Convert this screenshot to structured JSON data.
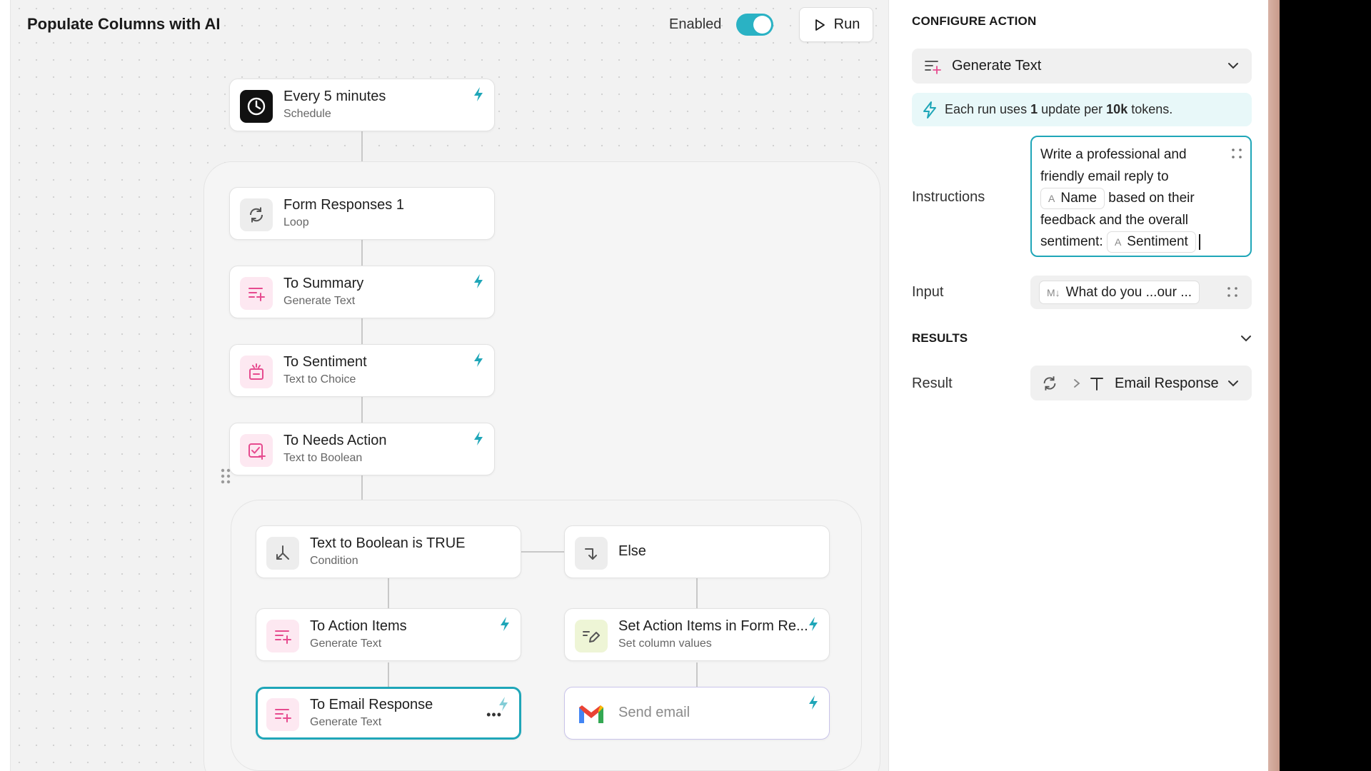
{
  "title": "Populate Columns with AI",
  "header": {
    "enabled_label": "Enabled",
    "enabled": true,
    "run_label": "Run"
  },
  "nodes": {
    "schedule": {
      "title": "Every 5 minutes",
      "subtitle": "Schedule",
      "icon": "clock-icon"
    },
    "loop": {
      "title": "Form Responses 1",
      "subtitle": "Loop",
      "icon": "loop-icon"
    },
    "summary": {
      "title": "To Summary",
      "subtitle": "Generate Text",
      "icon": "generate-text-icon"
    },
    "sentiment": {
      "title": "To Sentiment",
      "subtitle": "Text to Choice",
      "icon": "text-to-choice-icon"
    },
    "needs_action": {
      "title": "To Needs Action",
      "subtitle": "Text to Boolean",
      "icon": "text-to-boolean-icon"
    },
    "condition": {
      "title": "Text to Boolean is TRUE",
      "subtitle": "Condition",
      "icon": "branch-icon"
    },
    "else": {
      "title": "Else",
      "icon": "else-arrow-icon"
    },
    "action_items": {
      "title": "To Action Items",
      "subtitle": "Generate Text",
      "icon": "generate-text-icon"
    },
    "set_action_items": {
      "title": "Set Action Items in Form Re...",
      "subtitle": "Set column values",
      "icon": "edit-icon"
    },
    "email_response": {
      "title": "To Email Response",
      "subtitle": "Generate Text",
      "icon": "generate-text-icon",
      "more": "•••"
    },
    "send_email": {
      "title": "Send email",
      "icon": "gmail-icon"
    }
  },
  "panel": {
    "header": "CONFIGURE ACTION",
    "action_select": "Generate Text",
    "info": {
      "prefix": "Each run uses ",
      "count": "1",
      "middle": " update per ",
      "tokens": "10k",
      "suffix": " tokens."
    },
    "instructions_label": "Instructions",
    "instructions": {
      "part1": "Write a professional and friendly email reply to ",
      "chip1": "Name",
      "part2": " based on their feedback and the overall sentiment: ",
      "chip2": "Sentiment",
      "chip_glyph": "A"
    },
    "input_label": "Input",
    "input_value": "What do you ...our ...",
    "input_glyph": "M↓",
    "results_header": "RESULTS",
    "result_label": "Result",
    "result_value": "Email Response"
  },
  "colors": {
    "accent": "#1fa6b8",
    "toggle": "#2ab2c4",
    "pink_icon": "#e64b8f",
    "info_bg": "#e8f8f9"
  }
}
